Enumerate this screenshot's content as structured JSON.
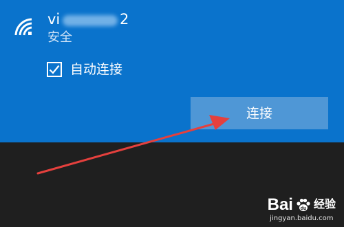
{
  "network": {
    "name_prefix": "vi",
    "name_suffix": "2",
    "security": "安全",
    "icon": "wifi-icon"
  },
  "auto_connect": {
    "label": "自动连接",
    "checked": true
  },
  "connect_button": {
    "label": "连接"
  },
  "annotation": {
    "icon": "red-arrow",
    "color": "#e5403d"
  },
  "watermark": {
    "brand_left": "Bai",
    "brand_right": "经验",
    "url": "jingyan.baidu.com"
  },
  "colors": {
    "panel": "#0a73cc",
    "button": "#4f97d6",
    "background": "#1f1f1f"
  }
}
